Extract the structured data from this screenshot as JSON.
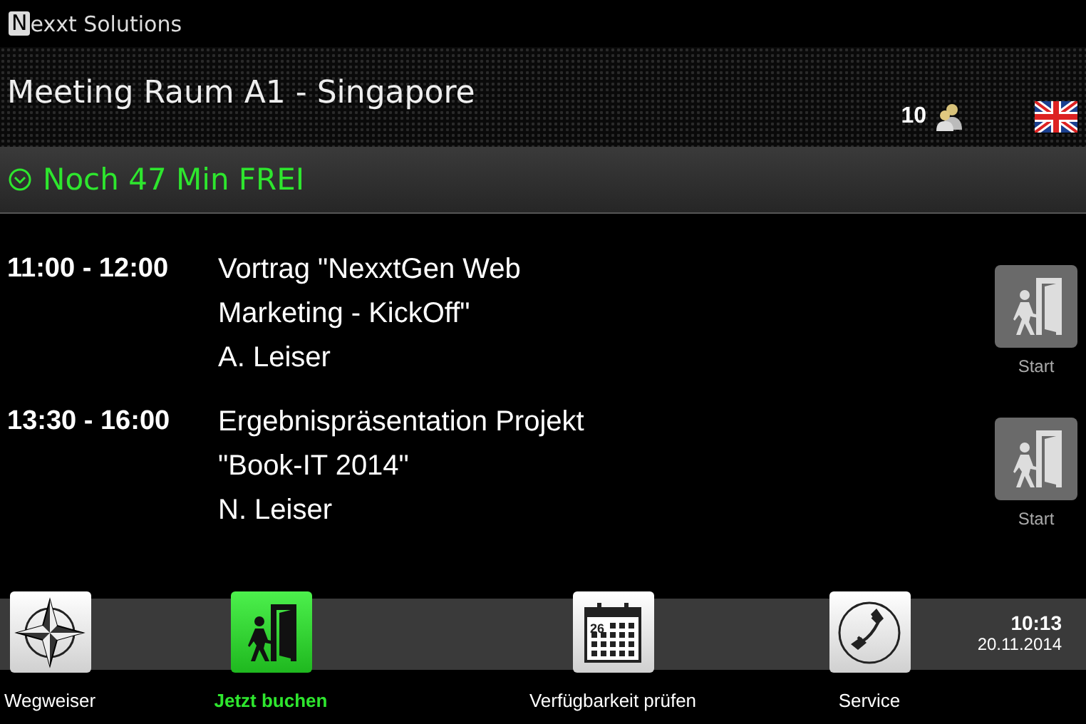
{
  "brand": {
    "initial": "N",
    "rest": "exxt Solutions"
  },
  "room": {
    "title": "Meeting Raum A1 - Singapore",
    "capacity": "10"
  },
  "status": {
    "text": "Noch 47 Min FREI"
  },
  "meetings": [
    {
      "time": "11:00 - 12:00",
      "title": "Vortrag \"NexxtGen Web Marketing - KickOff\"",
      "host": "A. Leiser",
      "action": "Start"
    },
    {
      "time": "13:30 - 16:00",
      "title": "Ergebnispräsentation Projekt \"Book-IT 2014\"",
      "host": "N. Leiser",
      "action": "Start"
    }
  ],
  "nav": [
    {
      "kind": "compass",
      "label": "Wegweiser",
      "selected": false
    },
    {
      "kind": "door",
      "label": "Jetzt buchen",
      "selected": true
    },
    {
      "kind": "calendar",
      "label": "Verfügbarkeit prüfen",
      "selected": false,
      "day": "26"
    },
    {
      "kind": "phone",
      "label": "Service",
      "selected": false
    }
  ],
  "clock": {
    "time": "10:13",
    "date": "20.11.2014"
  }
}
